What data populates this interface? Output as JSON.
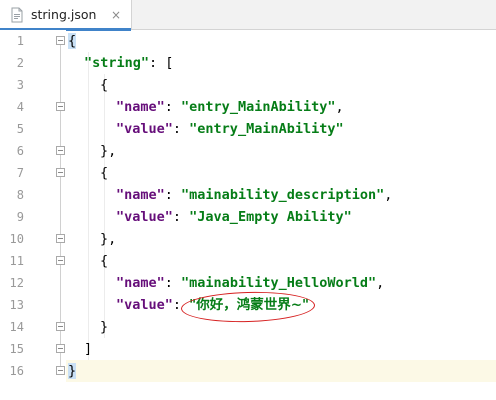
{
  "tab": {
    "filename": "string.json",
    "close_glyph": "×",
    "icon": "json-file-icon"
  },
  "colors": {
    "key": "#660e7a",
    "string": "#067d17",
    "annotation": "#d62020",
    "tab_accent": "#4083c9"
  },
  "editor": {
    "line_numbers": [
      "1",
      "2",
      "3",
      "4",
      "5",
      "6",
      "7",
      "8",
      "9",
      "10",
      "11",
      "12",
      "13",
      "14",
      "15",
      "16"
    ],
    "lines": [
      {
        "num": "1",
        "text": "{"
      },
      {
        "num": "2",
        "key": "\"string\"",
        "rest": ": ["
      },
      {
        "num": "3",
        "text": "{"
      },
      {
        "num": "4",
        "key": "\"name\"",
        "sep": ": ",
        "value": "\"entry_MainAbility\"",
        "tail": ","
      },
      {
        "num": "5",
        "key": "\"value\"",
        "sep": ": ",
        "value": "\"entry_MainAbility\"",
        "tail": ""
      },
      {
        "num": "6",
        "text": "},"
      },
      {
        "num": "7",
        "text": "{"
      },
      {
        "num": "8",
        "key": "\"name\"",
        "sep": ": ",
        "value": "\"mainability_description\"",
        "tail": ","
      },
      {
        "num": "9",
        "key": "\"value\"",
        "sep": ": ",
        "value": "\"Java_Empty Ability\"",
        "tail": ""
      },
      {
        "num": "10",
        "text": "},"
      },
      {
        "num": "11",
        "text": "{"
      },
      {
        "num": "12",
        "key": "\"name\"",
        "sep": ": ",
        "value": "\"mainability_HelloWorld\"",
        "tail": ","
      },
      {
        "num": "13",
        "key": "\"value\"",
        "sep": ": ",
        "value": "\"你好，鸿蒙世界~\"",
        "tail": ""
      },
      {
        "num": "14",
        "text": "}"
      },
      {
        "num": "15",
        "text": "]"
      },
      {
        "num": "16",
        "text": "}"
      }
    ]
  }
}
